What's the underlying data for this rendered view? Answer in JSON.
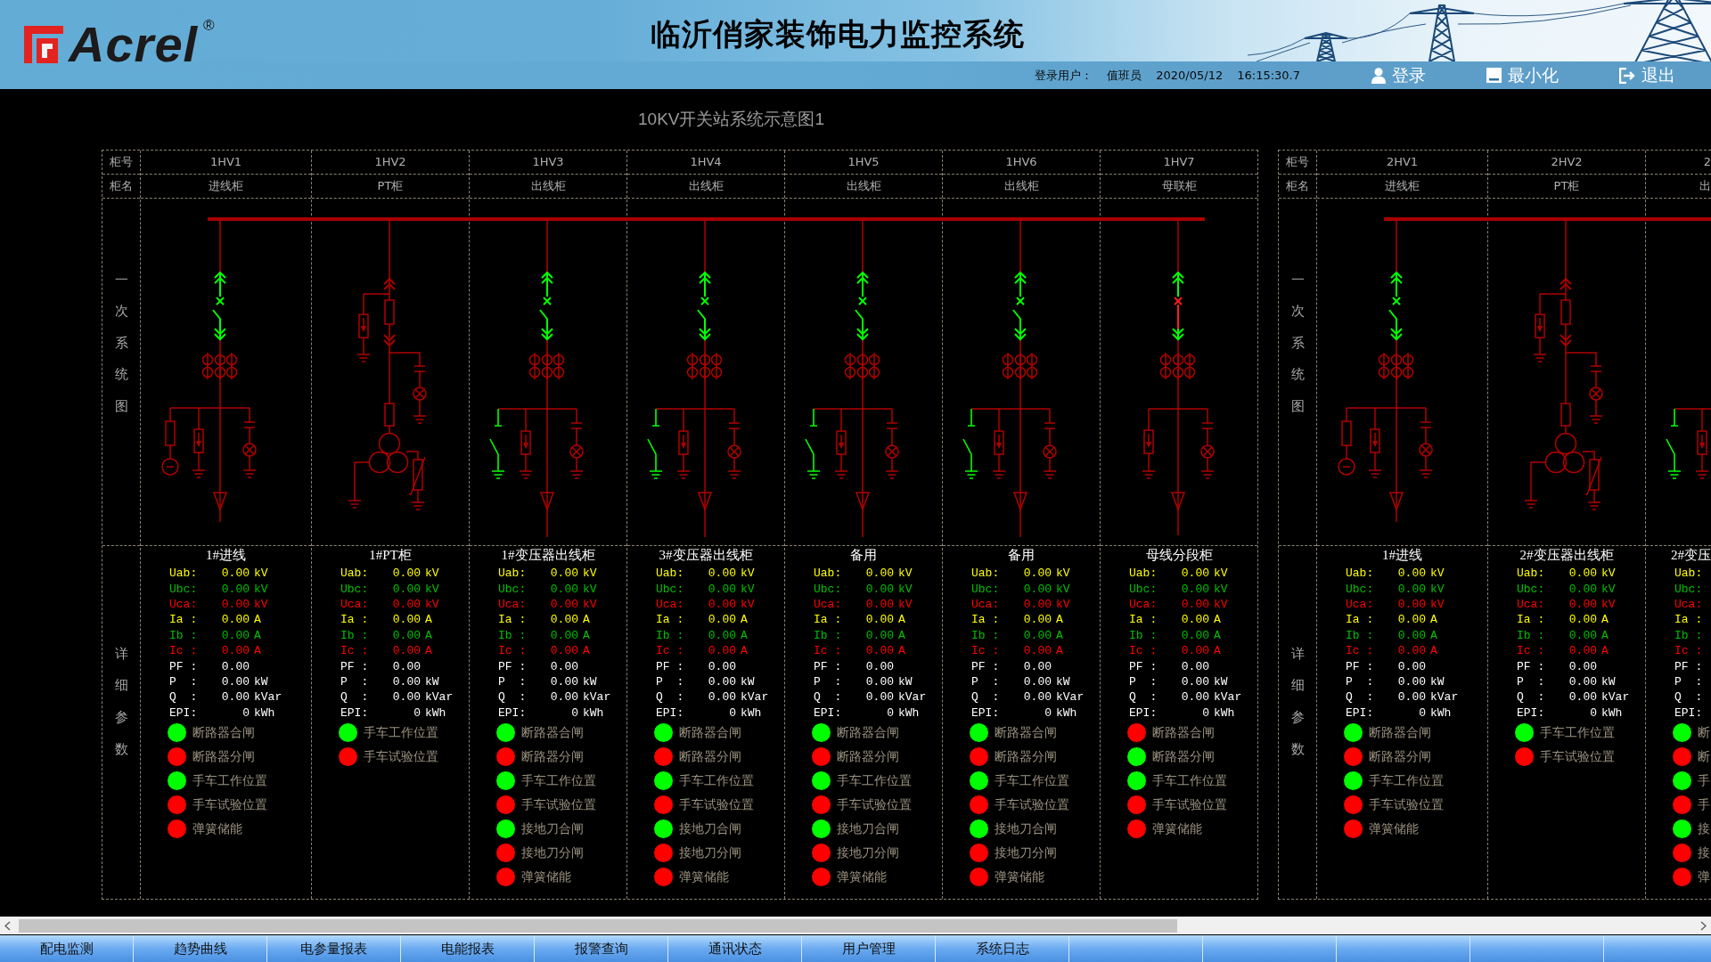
{
  "header": {
    "logo": {
      "text": "Acrel",
      "mark": "®"
    },
    "title": "临沂俏家装饰电力监控系统",
    "user_label": "登录用户：",
    "user": "值班员",
    "date": "2020/05/12",
    "time": "16:15:30.7",
    "buttons": [
      {
        "label": "登录",
        "kind": "login"
      },
      {
        "label": "最小化",
        "kind": "minimize"
      },
      {
        "label": "退出",
        "kind": "exit"
      }
    ]
  },
  "diagram_title": "10KV开关站系统示意图1",
  "panels": [
    {
      "number_label": "柜号",
      "name_label": "柜名",
      "diagram_label": "一次系统图",
      "detail_label": "详细参数",
      "cabinets": [
        {
          "number": "1HV1",
          "name": "进线柜",
          "kind": "incoming",
          "breaker_closed": true,
          "title": "1#进线",
          "params": [
            {
              "label": "Uab:",
              "value": "0.00",
              "unit": "kV",
              "color": "#ffff00"
            },
            {
              "label": "Ubc:",
              "value": "0.00",
              "unit": "kV",
              "color": "#00c000"
            },
            {
              "label": "Uca:",
              "value": "0.00",
              "unit": "kV",
              "color": "#ff0000"
            },
            {
              "label": "Ia :",
              "value": "0.00",
              "unit": "A",
              "color": "#ffff00"
            },
            {
              "label": "Ib :",
              "value": "0.00",
              "unit": "A",
              "color": "#00c000"
            },
            {
              "label": "Ic :",
              "value": "0.00",
              "unit": "A",
              "color": "#ff0000"
            },
            {
              "label": "PF :",
              "value": "0.00",
              "color": "#ffffff"
            },
            {
              "label": "P  :",
              "value": "0.00",
              "unit": "kW",
              "color": "#ffffff"
            },
            {
              "label": "Q  :",
              "value": "0.00",
              "unit": "kVar",
              "color": "#ffffff"
            },
            {
              "label": "EPI:",
              "value": "0",
              "unit": "kWh",
              "color": "#ffffff"
            }
          ],
          "lamps": [
            {
              "label": "断路器合闸",
              "on": true
            },
            {
              "label": "断路器分闸",
              "on": false
            },
            {
              "label": "手车工作位置",
              "on": true
            },
            {
              "label": "手车试验位置",
              "on": false
            },
            {
              "label": "弹簧储能",
              "on": false
            }
          ]
        },
        {
          "number": "1HV2",
          "name": "PT柜",
          "kind": "pt",
          "title": "1#PT柜",
          "params": [
            {
              "label": "Uab:",
              "value": "0.00",
              "unit": "kV",
              "color": "#ffff00"
            },
            {
              "label": "Ubc:",
              "value": "0.00",
              "unit": "kV",
              "color": "#00c000"
            },
            {
              "label": "Uca:",
              "value": "0.00",
              "unit": "kV",
              "color": "#ff0000"
            },
            {
              "label": "Ia :",
              "value": "0.00",
              "unit": "A",
              "color": "#ffff00"
            },
            {
              "label": "Ib :",
              "value": "0.00",
              "unit": "A",
              "color": "#00c000"
            },
            {
              "label": "Ic :",
              "value": "0.00",
              "unit": "A",
              "color": "#ff0000"
            },
            {
              "label": "PF :",
              "value": "0.00",
              "color": "#ffffff"
            },
            {
              "label": "P  :",
              "value": "0.00",
              "unit": "kW",
              "color": "#ffffff"
            },
            {
              "label": "Q  :",
              "value": "0.00",
              "unit": "kVar",
              "color": "#ffffff"
            },
            {
              "label": "EPI:",
              "value": "0",
              "unit": "kWh",
              "color": "#ffffff"
            }
          ],
          "lamps": [
            {
              "label": "手车工作位置",
              "on": true
            },
            {
              "label": "手车试验位置",
              "on": false
            }
          ]
        },
        {
          "number": "1HV3",
          "name": "出线柜",
          "kind": "outgoing",
          "breaker_closed": true,
          "title": "1#变压器出线柜",
          "params": [
            {
              "label": "Uab:",
              "value": "0.00",
              "unit": "kV",
              "color": "#ffff00"
            },
            {
              "label": "Ubc:",
              "value": "0.00",
              "unit": "kV",
              "color": "#00c000"
            },
            {
              "label": "Uca:",
              "value": "0.00",
              "unit": "kV",
              "color": "#ff0000"
            },
            {
              "label": "Ia :",
              "value": "0.00",
              "unit": "A",
              "color": "#ffff00"
            },
            {
              "label": "Ib :",
              "value": "0.00",
              "unit": "A",
              "color": "#00c000"
            },
            {
              "label": "Ic :",
              "value": "0.00",
              "unit": "A",
              "color": "#ff0000"
            },
            {
              "label": "PF :",
              "value": "0.00",
              "color": "#ffffff"
            },
            {
              "label": "P  :",
              "value": "0.00",
              "unit": "kW",
              "color": "#ffffff"
            },
            {
              "label": "Q  :",
              "value": "0.00",
              "unit": "kVar",
              "color": "#ffffff"
            },
            {
              "label": "EPI:",
              "value": "0",
              "unit": "kWh",
              "color": "#ffffff"
            }
          ],
          "lamps": [
            {
              "label": "断路器合闸",
              "on": true
            },
            {
              "label": "断路器分闸",
              "on": false
            },
            {
              "label": "手车工作位置",
              "on": true
            },
            {
              "label": "手车试验位置",
              "on": false
            },
            {
              "label": "接地刀合闸",
              "on": true
            },
            {
              "label": "接地刀分闸",
              "on": false
            },
            {
              "label": "弹簧储能",
              "on": false
            }
          ]
        },
        {
          "number": "1HV4",
          "name": "出线柜",
          "kind": "outgoing",
          "breaker_closed": true,
          "title": "3#变压器出线柜",
          "params": [
            {
              "label": "Uab:",
              "value": "0.00",
              "unit": "kV",
              "color": "#ffff00"
            },
            {
              "label": "Ubc:",
              "value": "0.00",
              "unit": "kV",
              "color": "#00c000"
            },
            {
              "label": "Uca:",
              "value": "0.00",
              "unit": "kV",
              "color": "#ff0000"
            },
            {
              "label": "Ia :",
              "value": "0.00",
              "unit": "A",
              "color": "#ffff00"
            },
            {
              "label": "Ib :",
              "value": "0.00",
              "unit": "A",
              "color": "#00c000"
            },
            {
              "label": "Ic :",
              "value": "0.00",
              "unit": "A",
              "color": "#ff0000"
            },
            {
              "label": "PF :",
              "value": "0.00",
              "color": "#ffffff"
            },
            {
              "label": "P  :",
              "value": "0.00",
              "unit": "kW",
              "color": "#ffffff"
            },
            {
              "label": "Q  :",
              "value": "0.00",
              "unit": "kVar",
              "color": "#ffffff"
            },
            {
              "label": "EPI:",
              "value": "0",
              "unit": "kWh",
              "color": "#ffffff"
            }
          ],
          "lamps": [
            {
              "label": "断路器合闸",
              "on": true
            },
            {
              "label": "断路器分闸",
              "on": false
            },
            {
              "label": "手车工作位置",
              "on": true
            },
            {
              "label": "手车试验位置",
              "on": false
            },
            {
              "label": "接地刀合闸",
              "on": true
            },
            {
              "label": "接地刀分闸",
              "on": false
            },
            {
              "label": "弹簧储能",
              "on": false
            }
          ]
        },
        {
          "number": "1HV5",
          "name": "出线柜",
          "kind": "outgoing",
          "breaker_closed": true,
          "title": "备用",
          "params": [
            {
              "label": "Uab:",
              "value": "0.00",
              "unit": "kV",
              "color": "#ffff00"
            },
            {
              "label": "Ubc:",
              "value": "0.00",
              "unit": "kV",
              "color": "#00c000"
            },
            {
              "label": "Uca:",
              "value": "0.00",
              "unit": "kV",
              "color": "#ff0000"
            },
            {
              "label": "Ia :",
              "value": "0.00",
              "unit": "A",
              "color": "#ffff00"
            },
            {
              "label": "Ib :",
              "value": "0.00",
              "unit": "A",
              "color": "#00c000"
            },
            {
              "label": "Ic :",
              "value": "0.00",
              "unit": "A",
              "color": "#ff0000"
            },
            {
              "label": "PF :",
              "value": "0.00",
              "color": "#ffffff"
            },
            {
              "label": "P  :",
              "value": "0.00",
              "unit": "kW",
              "color": "#ffffff"
            },
            {
              "label": "Q  :",
              "value": "0.00",
              "unit": "kVar",
              "color": "#ffffff"
            },
            {
              "label": "EPI:",
              "value": "0",
              "unit": "kWh",
              "color": "#ffffff"
            }
          ],
          "lamps": [
            {
              "label": "断路器合闸",
              "on": true
            },
            {
              "label": "断路器分闸",
              "on": false
            },
            {
              "label": "手车工作位置",
              "on": true
            },
            {
              "label": "手车试验位置",
              "on": false
            },
            {
              "label": "接地刀合闸",
              "on": true
            },
            {
              "label": "接地刀分闸",
              "on": false
            },
            {
              "label": "弹簧储能",
              "on": false
            }
          ]
        },
        {
          "number": "1HV6",
          "name": "出线柜",
          "kind": "outgoing",
          "breaker_closed": true,
          "title": "备用",
          "params": [
            {
              "label": "Uab:",
              "value": "0.00",
              "unit": "kV",
              "color": "#ffff00"
            },
            {
              "label": "Ubc:",
              "value": "0.00",
              "unit": "kV",
              "color": "#00c000"
            },
            {
              "label": "Uca:",
              "value": "0.00",
              "unit": "kV",
              "color": "#ff0000"
            },
            {
              "label": "Ia :",
              "value": "0.00",
              "unit": "A",
              "color": "#ffff00"
            },
            {
              "label": "Ib :",
              "value": "0.00",
              "unit": "A",
              "color": "#00c000"
            },
            {
              "label": "Ic :",
              "value": "0.00",
              "unit": "A",
              "color": "#ff0000"
            },
            {
              "label": "PF :",
              "value": "0.00",
              "color": "#ffffff"
            },
            {
              "label": "P  :",
              "value": "0.00",
              "unit": "kW",
              "color": "#ffffff"
            },
            {
              "label": "Q  :",
              "value": "0.00",
              "unit": "kVar",
              "color": "#ffffff"
            },
            {
              "label": "EPI:",
              "value": "0",
              "unit": "kWh",
              "color": "#ffffff"
            }
          ],
          "lamps": [
            {
              "label": "断路器合闸",
              "on": true
            },
            {
              "label": "断路器分闸",
              "on": false
            },
            {
              "label": "手车工作位置",
              "on": true
            },
            {
              "label": "手车试验位置",
              "on": false
            },
            {
              "label": "接地刀合闸",
              "on": true
            },
            {
              "label": "接地刀分闸",
              "on": false
            },
            {
              "label": "弹簧储能",
              "on": false
            }
          ]
        },
        {
          "number": "1HV7",
          "name": "母联柜",
          "kind": "bustie",
          "breaker_closed": false,
          "title": "母线分段柜",
          "params": [
            {
              "label": "Uab:",
              "value": "0.00",
              "unit": "kV",
              "color": "#ffff00"
            },
            {
              "label": "Ubc:",
              "value": "0.00",
              "unit": "kV",
              "color": "#00c000"
            },
            {
              "label": "Uca:",
              "value": "0.00",
              "unit": "kV",
              "color": "#ff0000"
            },
            {
              "label": "Ia :",
              "value": "0.00",
              "unit": "A",
              "color": "#ffff00"
            },
            {
              "label": "Ib :",
              "value": "0.00",
              "unit": "A",
              "color": "#00c000"
            },
            {
              "label": "Ic :",
              "value": "0.00",
              "unit": "A",
              "color": "#ff0000"
            },
            {
              "label": "PF :",
              "value": "0.00",
              "color": "#ffffff"
            },
            {
              "label": "P  :",
              "value": "0.00",
              "unit": "kW",
              "color": "#ffffff"
            },
            {
              "label": "Q  :",
              "value": "0.00",
              "unit": "kVar",
              "color": "#ffffff"
            },
            {
              "label": "EPI:",
              "value": "0",
              "unit": "kWh",
              "color": "#ffffff"
            }
          ],
          "lamps": [
            {
              "label": "断路器合闸",
              "on": false
            },
            {
              "label": "断路器分闸",
              "on": true
            },
            {
              "label": "手车工作位置",
              "on": true
            },
            {
              "label": "手车试验位置",
              "on": false
            },
            {
              "label": "弹簧储能",
              "on": false
            }
          ]
        }
      ]
    },
    {
      "number_label": "柜号",
      "name_label": "柜名",
      "diagram_label": "一次系统图",
      "detail_label": "详细参数",
      "cabinets": [
        {
          "number": "2HV1",
          "name": "进线柜",
          "kind": "incoming",
          "breaker_closed": true,
          "title": "1#进线",
          "params": [
            {
              "label": "Uab:",
              "value": "0.00",
              "unit": "kV",
              "color": "#ffff00"
            },
            {
              "label": "Ubc:",
              "value": "0.00",
              "unit": "kV",
              "color": "#00c000"
            },
            {
              "label": "Uca:",
              "value": "0.00",
              "unit": "kV",
              "color": "#ff0000"
            },
            {
              "label": "Ia :",
              "value": "0.00",
              "unit": "A",
              "color": "#ffff00"
            },
            {
              "label": "Ib :",
              "value": "0.00",
              "unit": "A",
              "color": "#00c000"
            },
            {
              "label": "Ic :",
              "value": "0.00",
              "unit": "A",
              "color": "#ff0000"
            },
            {
              "label": "PF :",
              "value": "0.00",
              "color": "#ffffff"
            },
            {
              "label": "P  :",
              "value": "0.00",
              "unit": "kW",
              "color": "#ffffff"
            },
            {
              "label": "Q  :",
              "value": "0.00",
              "unit": "kVar",
              "color": "#ffffff"
            },
            {
              "label": "EPI:",
              "value": "0",
              "unit": "kWh",
              "color": "#ffffff"
            }
          ],
          "lamps": [
            {
              "label": "断路器合闸",
              "on": true
            },
            {
              "label": "断路器分闸",
              "on": false
            },
            {
              "label": "手车工作位置",
              "on": true
            },
            {
              "label": "手车试验位置",
              "on": false
            },
            {
              "label": "弹簧储能",
              "on": false
            }
          ]
        },
        {
          "number": "2HV2",
          "name": "PT柜",
          "kind": "pt",
          "title": "2#变压器出线柜",
          "params": [
            {
              "label": "Uab:",
              "value": "0.00",
              "unit": "kV",
              "color": "#ffff00"
            },
            {
              "label": "Ubc:",
              "value": "0.00",
              "unit": "kV",
              "color": "#00c000"
            },
            {
              "label": "Uca:",
              "value": "0.00",
              "unit": "kV",
              "color": "#ff0000"
            },
            {
              "label": "Ia :",
              "value": "0.00",
              "unit": "A",
              "color": "#ffff00"
            },
            {
              "label": "Ib :",
              "value": "0.00",
              "unit": "A",
              "color": "#00c000"
            },
            {
              "label": "Ic :",
              "value": "0.00",
              "unit": "A",
              "color": "#ff0000"
            },
            {
              "label": "PF :",
              "value": "0.00",
              "color": "#ffffff"
            },
            {
              "label": "P  :",
              "value": "0.00",
              "unit": "kW",
              "color": "#ffffff"
            },
            {
              "label": "Q  :",
              "value": "0.00",
              "unit": "kVar",
              "color": "#ffffff"
            },
            {
              "label": "EPI:",
              "value": "0",
              "unit": "kWh",
              "color": "#ffffff"
            }
          ],
          "lamps": [
            {
              "label": "手车工作位置",
              "on": true
            },
            {
              "label": "手车试验位置",
              "on": false
            }
          ]
        },
        {
          "number": "2",
          "name": "出",
          "kind": "outgoing",
          "title": "2#变压",
          "params": [
            {
              "label": "Uab:",
              "color": "#ffff00"
            },
            {
              "label": "Ubc:",
              "color": "#00c000"
            },
            {
              "label": "Uca:",
              "color": "#ff0000"
            },
            {
              "label": "Ia :",
              "color": "#ffff00"
            },
            {
              "label": "Ib :",
              "color": "#00c000"
            },
            {
              "label": "Ic :",
              "color": "#ff0000"
            },
            {
              "label": "PF :",
              "color": "#ffffff"
            },
            {
              "label": "P  :",
              "color": "#ffffff"
            },
            {
              "label": "Q  :",
              "color": "#ffffff"
            },
            {
              "label": "EPI:",
              "color": "#ffffff"
            }
          ],
          "lamps": [
            {
              "label": "断",
              "on": true
            },
            {
              "label": "断",
              "on": false
            },
            {
              "label": "手",
              "on": true
            },
            {
              "label": "手",
              "on": false
            },
            {
              "label": "接",
              "on": true
            },
            {
              "label": "接",
              "on": false
            },
            {
              "label": "弹",
              "on": false
            }
          ]
        }
      ]
    }
  ],
  "tabs": [
    {
      "label": "配电监测"
    },
    {
      "label": "趋势曲线"
    },
    {
      "label": "电参量报表"
    },
    {
      "label": "电能报表"
    },
    {
      "label": "报警查询"
    },
    {
      "label": "通讯状态"
    },
    {
      "label": "用户管理"
    },
    {
      "label": "系统日志"
    }
  ]
}
